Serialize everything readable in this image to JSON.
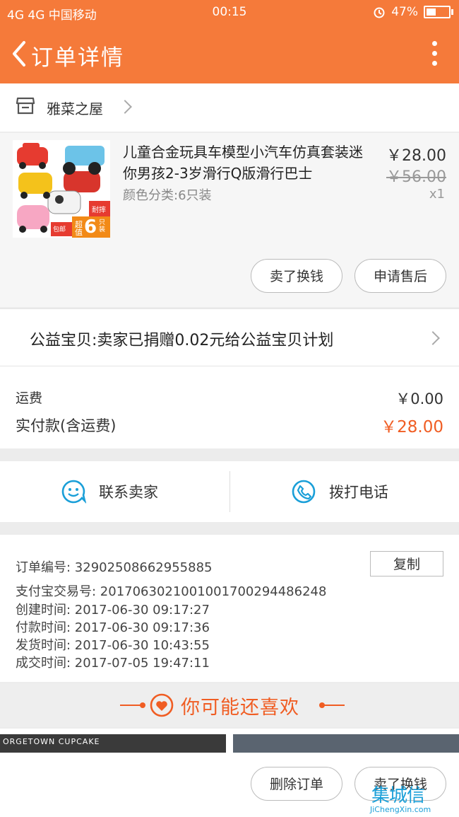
{
  "status_bar": {
    "carrier": "4G 4G 中国移动",
    "time": "00:15",
    "battery": "47%",
    "battery_level": 0.47
  },
  "nav": {
    "title": "订单详情"
  },
  "shop": {
    "name": "雅菜之屋"
  },
  "product": {
    "title": "儿童合金玩具车模型小汽车仿真套装迷你男孩2-3岁滑行Q版滑行巴士",
    "spec": "颜色分类:6只装",
    "price": "￥28.00",
    "original_price": "￥56.00",
    "quantity": "x1",
    "buttons": {
      "refund": "卖了换钱",
      "after_sale": "申请售后"
    },
    "badges": {
      "sale": "超值",
      "count": "6",
      "unit": "只装",
      "free_ship": "包邮",
      "sturdy": "耐摔"
    }
  },
  "charity": {
    "text": "公益宝贝:卖家已捐赠0.02元给公益宝贝计划"
  },
  "fees": {
    "shipping_label": "运费",
    "shipping_value": "￥0.00",
    "paid_label": "实付款(含运费)",
    "paid_value": "￥28.00"
  },
  "contact": {
    "seller": "联系卖家",
    "phone": "拨打电话"
  },
  "order_info": {
    "copy_label": "复制",
    "lines": [
      "订单编号:  32902508662955885",
      "支付宝交易号:  2017063021001001700294486248",
      "创建时间:  2017-06-30 09:17:27",
      "付款时间:  2017-06-30 09:17:36",
      "发货时间:  2017-06-30 10:43:55",
      "成交时间:  2017-07-05 19:47:11"
    ]
  },
  "recommend": {
    "title": "你可能还喜欢",
    "image_text": "ORGETOWN CUPCAKE"
  },
  "bottom": {
    "delete": "删除订单",
    "sell": "卖了换钱"
  },
  "watermark": {
    "title": "集城信",
    "url": "JiChengXin.com"
  },
  "colors": {
    "brand": "#f57a3a",
    "accent": "#f05d23",
    "link": "#1a9fd8"
  }
}
